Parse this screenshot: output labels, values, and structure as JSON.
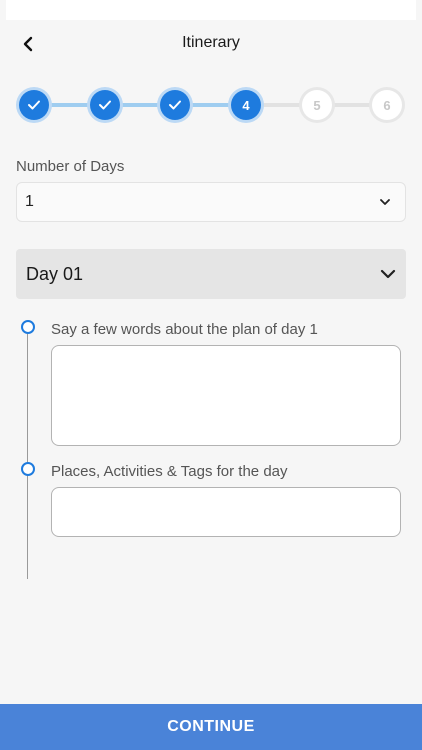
{
  "header": {
    "title": "Itinerary",
    "back_icon": "chevron-left-icon"
  },
  "stepper": {
    "accent_color": "#1e7bde",
    "steps": [
      {
        "state": "done",
        "label": ""
      },
      {
        "state": "done",
        "label": ""
      },
      {
        "state": "done",
        "label": ""
      },
      {
        "state": "current",
        "label": "4"
      },
      {
        "state": "todo",
        "label": "5"
      },
      {
        "state": "todo",
        "label": "6"
      }
    ]
  },
  "days": {
    "label": "Number of Days",
    "value": "1"
  },
  "day_section": {
    "title": "Day 01",
    "plan_label": "Say a few words about the plan of day 1",
    "plan_value": "",
    "places_label": "Places, Activities & Tags for the day",
    "places_value": ""
  },
  "footer": {
    "continue_label": "CONTINUE",
    "button_color": "#4a83d8"
  }
}
